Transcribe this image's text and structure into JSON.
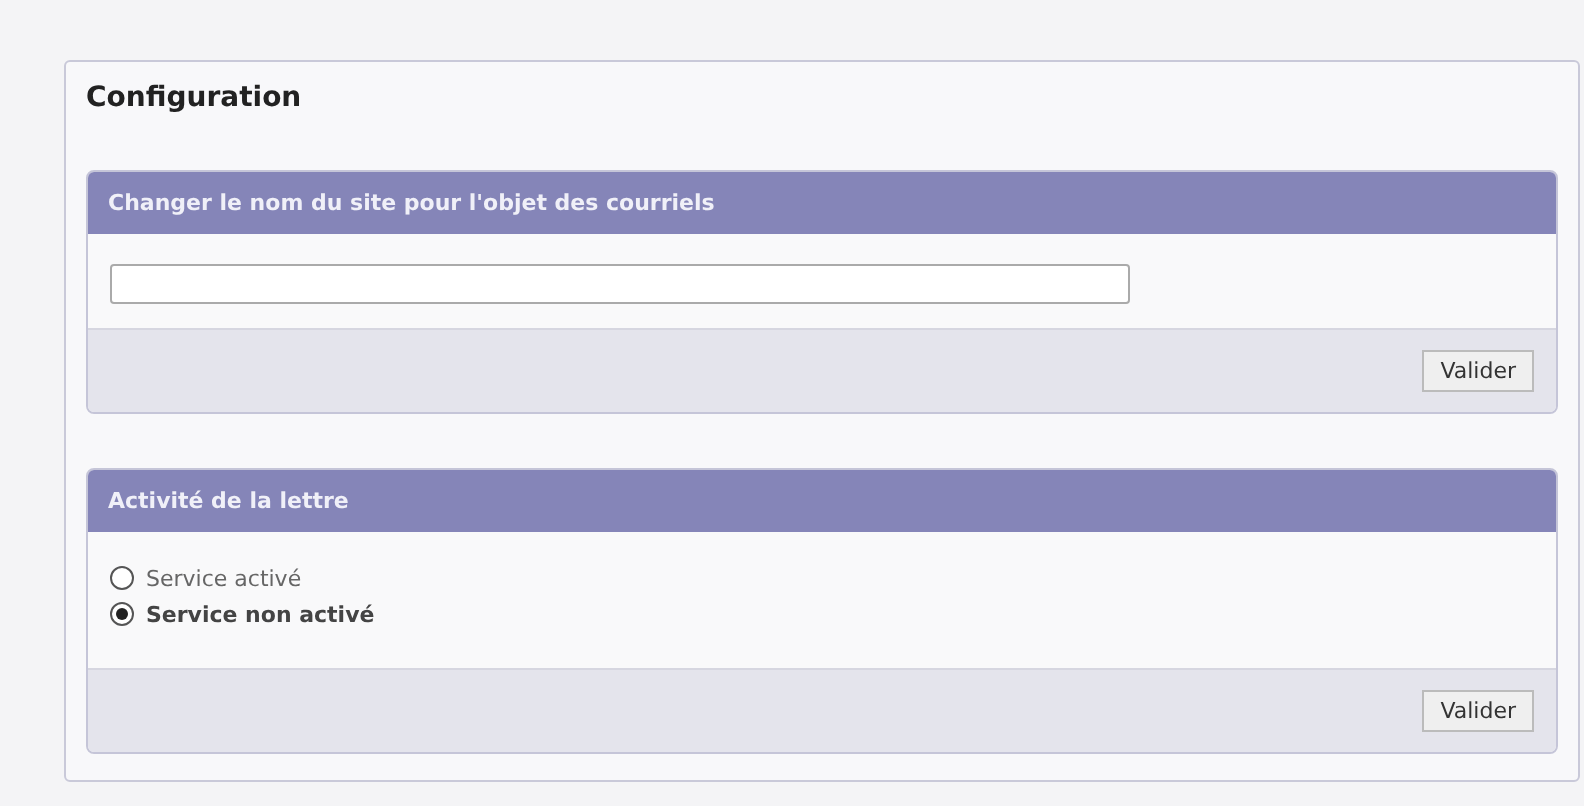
{
  "title": "Configuration",
  "sections": [
    {
      "kind": "text",
      "heading": "Changer le nom du site pour l'objet des courriels",
      "button": "Valider"
    },
    {
      "kind": "radio",
      "heading": "Activité de la lettre",
      "options": [
        {
          "label": "Service activé",
          "selected": false
        },
        {
          "label": "Service non activé",
          "selected": true
        }
      ],
      "button": "Valider"
    }
  ]
}
